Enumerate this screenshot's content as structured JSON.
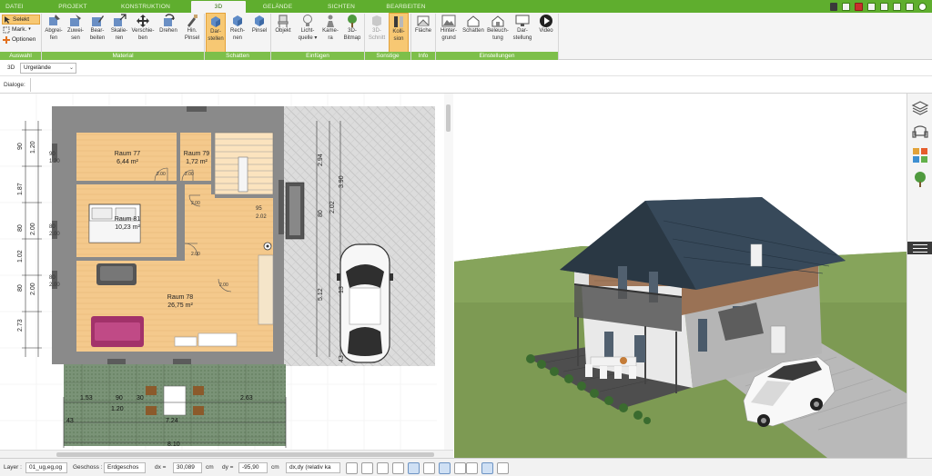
{
  "tabs": [
    "DATEI",
    "PROJEKT",
    "KONSTRUKTION",
    "3D",
    "GELÄNDE",
    "SICHTEN",
    "BEARBEITEN"
  ],
  "active_tab": "3D",
  "ribbon": {
    "selection": {
      "select": "Selekt",
      "mark": "Mark.",
      "options": "Optionen",
      "group": "Auswahl"
    },
    "material": {
      "group": "Material",
      "items": [
        "Abgrei-\nfen",
        "Zuwei-\nsen",
        "Bear-\nbeiten",
        "Skalie-\nren",
        "Verschie-\nben",
        "Drehen",
        "Hin.\nPinsel"
      ]
    },
    "shadow": {
      "group": "Schatten",
      "items": [
        "Dar-\nstellen",
        "Rech-\nnen",
        "Pinsel"
      ]
    },
    "insert": {
      "group": "Einfügen",
      "items": [
        "Objekt",
        "Licht-\nquelle ▾",
        "Kame-\nra",
        "3D-\nBitmap"
      ]
    },
    "other": {
      "group": "Sonstige",
      "items": [
        "3D-\nSchnitt",
        "Kolli-\nsion"
      ]
    },
    "info": {
      "group": "Info",
      "items": [
        "Fläche"
      ]
    },
    "settings": {
      "group": "Einstellungen",
      "items": [
        "Hinter-\ngrund",
        "Schatten",
        "Beleuch-\ntung",
        "Dar-\nstellung",
        "Video"
      ]
    }
  },
  "toolbar": {
    "mode_label": "3D",
    "terrain_value": "Urgelände",
    "dialogs_label": "Dialoge:"
  },
  "plan": {
    "rooms": [
      {
        "name": "Raum 77",
        "area": "6,44 m²"
      },
      {
        "name": "Raum 79",
        "area": "1,72 m²"
      },
      {
        "name": "Raum 81",
        "area": "10,23 m²"
      },
      {
        "name": "Raum 78",
        "area": "26,75 m²"
      }
    ],
    "dims_left": [
      "90",
      "1.20",
      "1.87",
      "80",
      "2.00",
      "1.02",
      "80",
      "2.00",
      "2.73"
    ],
    "dims_right": [
      "2.94",
      "3.90",
      "2.02",
      "80",
      "5.12",
      "43",
      "13"
    ],
    "dims_bottom": [
      "1.53",
      "90",
      "30",
      "1.20",
      "2.63",
      "7.24",
      "43",
      "8.10"
    ],
    "small_labels": [
      "90",
      "1.20",
      "80",
      "2.00",
      "80",
      "2.00",
      "2.00",
      "2.00",
      "95",
      "2.02",
      "1.00"
    ]
  },
  "status_bar": {
    "layer_label": "Layer :",
    "layer_value": "01_ug,eg,og",
    "floor_label": "Geschoss :",
    "floor_value": "Erdgeschos",
    "dx_label": "dx =",
    "dx_value": "30,089",
    "dx_unit": "cm",
    "dy_label": "dy =",
    "dy_value": "-95,90",
    "dy_unit": "cm",
    "mode_value": "dx,dy (relativ ka"
  }
}
